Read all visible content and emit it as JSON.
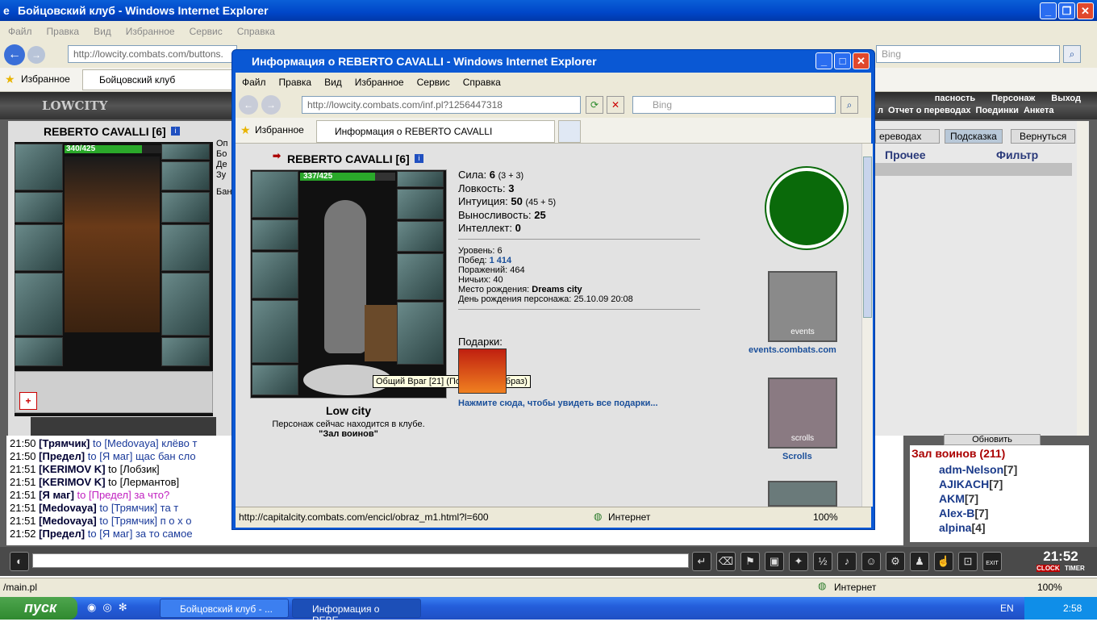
{
  "main_window": {
    "title": "Бойцовский клуб - Windows Internet Explorer",
    "menu": [
      "Файл",
      "Правка",
      "Вид",
      "Избранное",
      "Сервис",
      "Справка"
    ],
    "address": "http://lowcity.combats.com/buttons.",
    "search_placeholder": "Bing",
    "favorites": "Избранное",
    "tab": "Бойцовский клуб"
  },
  "game": {
    "logo": "LOWCITY",
    "char_name": "REBERTO CAVALLI [6]",
    "hp": "340/425",
    "top_menu": [
      "пасность",
      "Персонаж",
      "Выход"
    ],
    "top_menu2": [
      "л",
      "Отчет о переводах",
      "Поединки",
      "Анкета"
    ],
    "right_buttons": [
      "ереводах",
      "Подсказка",
      "Вернуться"
    ],
    "right_headers": [
      "Прочее",
      "Фильтр"
    ],
    "refresh": "Обновить",
    "online_title": "Зал воинов (211)",
    "online": [
      {
        "name": "adm-Nelson",
        "lvl": "[7]"
      },
      {
        "name": "AJIKACH",
        "lvl": "[7]"
      },
      {
        "name": "AKM",
        "lvl": "[7]"
      },
      {
        "name": "Alex-B",
        "lvl": "[7]"
      },
      {
        "name": "alpina",
        "lvl": "[4]"
      }
    ],
    "side_labels": [
      "Оп",
      "Бо",
      "Де",
      "Зу",
      "Бан"
    ],
    "clock": "21:52",
    "clock_sub": "CLOCK",
    "timer": "TIMER",
    "exit": "EXIT"
  },
  "chat": [
    {
      "time": "21:50",
      "from": "Трямчик",
      "to": "to [Medovaya]",
      "text": "клёво т"
    },
    {
      "time": "21:50",
      "from": "Предел",
      "to": "to [Я маг]",
      "text": "щас бан сло"
    },
    {
      "time": "21:51",
      "from": "KERIMOV K",
      "to": "to [Лобзик]",
      "text": ""
    },
    {
      "time": "21:51",
      "from": "KERIMOV K",
      "to": "to [Лермантов]",
      "text": ""
    },
    {
      "time": "21:51",
      "from": "Я маг",
      "to": "to [Предел]",
      "text": "за что?"
    },
    {
      "time": "21:51",
      "from": "Medovaya",
      "to": "to [Трямчик]",
      "text": "та т"
    },
    {
      "time": "21:51",
      "from": "Medovaya",
      "to": "to [Трямчик]",
      "text": "п о х о"
    },
    {
      "time": "21:52",
      "from": "Предел",
      "to": "to [Я маг]",
      "text": "за то самое"
    }
  ],
  "main_status": {
    "left": "/main.pl",
    "zone": "Интернет",
    "zoom": "100%"
  },
  "popup": {
    "title": "Информация о REBERTO CAVALLI - Windows Internet Explorer",
    "menu": [
      "Файл",
      "Правка",
      "Вид",
      "Избранное",
      "Сервис",
      "Справка"
    ],
    "address": "http://lowcity.combats.com/inf.pl?1256447318",
    "search_placeholder": "Bing",
    "favorites": "Избранное",
    "tab": "Информация о REBERTO CAVALLI",
    "char_name": "REBERTO CAVALLI [6]",
    "hp": "337/425",
    "stats": [
      {
        "label": "Сила:",
        "value": "6",
        "extra": "(3 + 3)"
      },
      {
        "label": "Ловкость:",
        "value": "3",
        "extra": ""
      },
      {
        "label": "Интуиция:",
        "value": "50",
        "extra": "(45 + 5)"
      },
      {
        "label": "Выносливость:",
        "value": "25",
        "extra": ""
      },
      {
        "label": "Интеллект:",
        "value": "0",
        "extra": ""
      }
    ],
    "info": [
      {
        "label": "Уровень:",
        "value": "6"
      },
      {
        "label": "Побед:",
        "value": "1 414"
      },
      {
        "label": "Поражений:",
        "value": "464"
      },
      {
        "label": "Ничьих:",
        "value": "40"
      },
      {
        "label": "Место рождения:",
        "value": "Dreams city"
      },
      {
        "label": "День рождения персонажа:",
        "value": "25.10.09 20:08"
      }
    ],
    "gifts_label": "Подарки:",
    "gifts_link": "Нажмите сюда, чтобы увидеть все подарки...",
    "tooltip": "Общий Враг [21] (Посмотреть образ)",
    "city": "Low city",
    "location_text": "Персонаж сейчас находится в клубе.",
    "location": "\"Зал воинов\"",
    "banner1": "events.combats.com",
    "banner1_word": "events",
    "banner2": "Scrolls",
    "banner2_word": "scrolls",
    "status_url": "http://capitalcity.combats.com/encicl/obraz_m1.html?l=600",
    "status_zone": "Интернет",
    "status_zoom": "100%"
  },
  "taskbar": {
    "start": "пуск",
    "task1": "Бойцовский клуб - ...",
    "task2": "Информация о REBE...",
    "lang": "EN",
    "time": "2:58"
  },
  "colors": {
    "xp_blue": "#0046c8",
    "game_bg": "#5e5e5e",
    "link": "#1a4f9a",
    "hp_green": "#2aa82a",
    "emblem_green": "#0a6a0a"
  }
}
